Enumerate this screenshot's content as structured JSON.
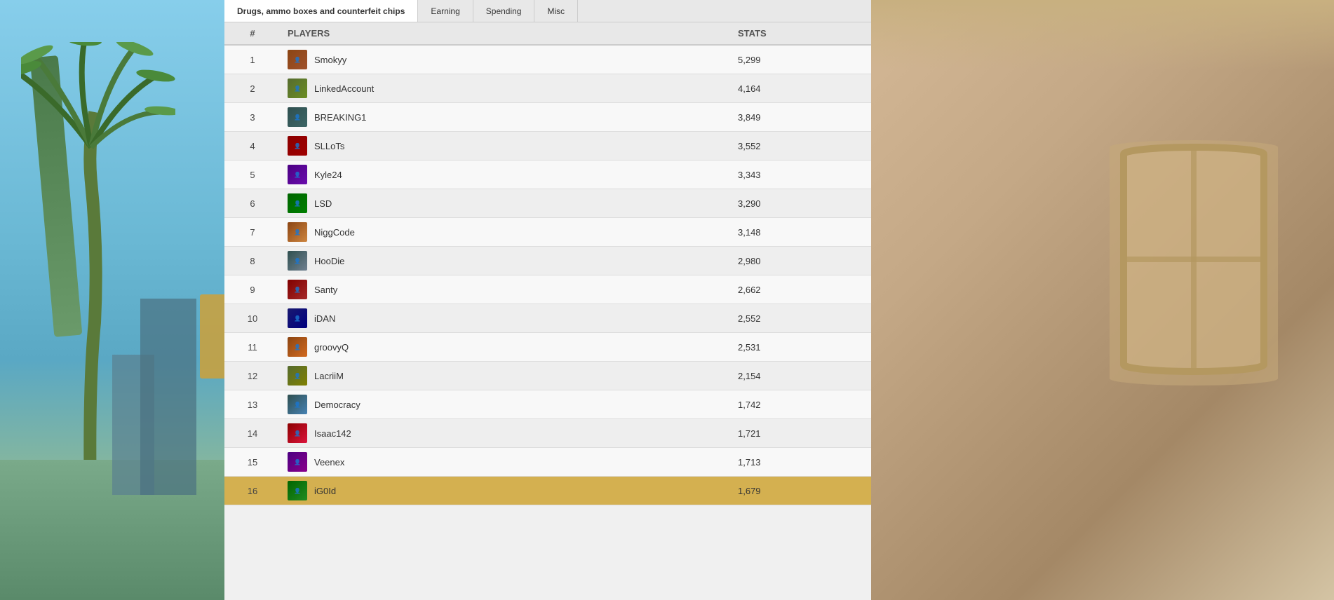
{
  "tabs": [
    {
      "id": "drugs",
      "label": "Drugs, ammo boxes and counterfeit chips",
      "active": true
    },
    {
      "id": "earning",
      "label": "Earning",
      "active": false
    },
    {
      "id": "spending",
      "label": "Spending",
      "active": false
    },
    {
      "id": "misc",
      "label": "Misc",
      "active": false
    }
  ],
  "table": {
    "col_num": "#",
    "col_player": "PLAYERS",
    "col_stats": "STATS",
    "rows": [
      {
        "rank": 1,
        "name": "Smokyy",
        "stats": "5,299",
        "highlighted": false,
        "avatarClass": "avatar-1"
      },
      {
        "rank": 2,
        "name": "LinkedAccount",
        "stats": "4,164",
        "highlighted": false,
        "avatarClass": "avatar-2"
      },
      {
        "rank": 3,
        "name": "BREAKING1",
        "stats": "3,849",
        "highlighted": false,
        "avatarClass": "avatar-3"
      },
      {
        "rank": 4,
        "name": "SLLoTs",
        "stats": "3,552",
        "highlighted": false,
        "avatarClass": "avatar-4"
      },
      {
        "rank": 5,
        "name": "Kyle24",
        "stats": "3,343",
        "highlighted": false,
        "avatarClass": "avatar-5"
      },
      {
        "rank": 6,
        "name": "LSD",
        "stats": "3,290",
        "highlighted": false,
        "avatarClass": "avatar-6"
      },
      {
        "rank": 7,
        "name": "NiggCode",
        "stats": "3,148",
        "highlighted": false,
        "avatarClass": "avatar-7"
      },
      {
        "rank": 8,
        "name": "HooDie",
        "stats": "2,980",
        "highlighted": false,
        "avatarClass": "avatar-8"
      },
      {
        "rank": 9,
        "name": "Santy",
        "stats": "2,662",
        "highlighted": false,
        "avatarClass": "avatar-9"
      },
      {
        "rank": 10,
        "name": "iDAN",
        "stats": "2,552",
        "highlighted": false,
        "avatarClass": "avatar-10"
      },
      {
        "rank": 11,
        "name": "groovyQ",
        "stats": "2,531",
        "highlighted": false,
        "avatarClass": "avatar-11"
      },
      {
        "rank": 12,
        "name": "LacriiM",
        "stats": "2,154",
        "highlighted": false,
        "avatarClass": "avatar-12"
      },
      {
        "rank": 13,
        "name": "Democracy",
        "stats": "1,742",
        "highlighted": false,
        "avatarClass": "avatar-13"
      },
      {
        "rank": 14,
        "name": "Isaac142",
        "stats": "1,721",
        "highlighted": false,
        "avatarClass": "avatar-14"
      },
      {
        "rank": 15,
        "name": "Veenex",
        "stats": "1,713",
        "highlighted": false,
        "avatarClass": "avatar-15"
      },
      {
        "rank": 16,
        "name": "iG0Id",
        "stats": "1,679",
        "highlighted": true,
        "avatarClass": "avatar-16"
      }
    ]
  }
}
